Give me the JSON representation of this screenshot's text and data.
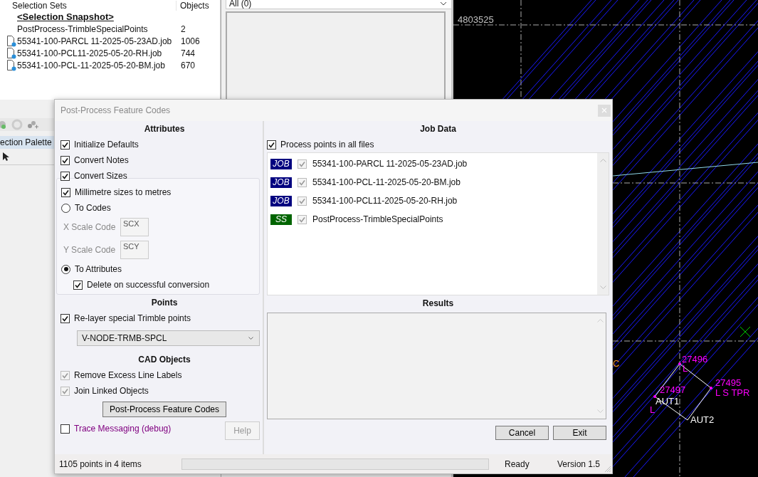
{
  "selection_sets": {
    "columns": [
      "Selection Sets",
      "Objects"
    ],
    "rows": [
      {
        "kind": "snapshot",
        "name": "<Selection Snapshot>"
      },
      {
        "kind": "set",
        "name": "PostProcess-TrimbleSpecialPoints",
        "objects": "2"
      },
      {
        "kind": "job",
        "name": "55341-100-PARCL 11-2025-05-23AD.job",
        "objects": "1006"
      },
      {
        "kind": "job",
        "name": "55341-100-PCL11-2025-05-20-RH.job",
        "objects": "744"
      },
      {
        "kind": "job",
        "name": "55341-100-PCL-11-2025-05-20-BM.job",
        "objects": "670"
      }
    ]
  },
  "filter": {
    "value": "All (0)"
  },
  "palette": {
    "tab": "ection Palette"
  },
  "cad": {
    "labels": [
      {
        "text": "4803525",
        "color": "#c0c0c0"
      },
      {
        "text": "C",
        "color": "#ff9933"
      },
      {
        "text": "27496",
        "color": "#ff00ff"
      },
      {
        "text": "L",
        "color": "#ff00ff"
      },
      {
        "text": "27495",
        "color": "#ff00ff"
      },
      {
        "text": "27497",
        "color": "#ff00ff"
      },
      {
        "text": "L S TPR",
        "color": "#ff00ff"
      },
      {
        "text": "AUT1",
        "color": "#ffffff"
      },
      {
        "text": "L",
        "color": "#ff00ff"
      },
      {
        "text": "AUT2",
        "color": "#ffffff"
      }
    ]
  },
  "dialog": {
    "title": "Post-Process Feature Codes",
    "attributes": {
      "heading": "Attributes",
      "options": [
        {
          "label": "Initialize Defaults",
          "checked": true
        },
        {
          "label": "Convert Notes",
          "checked": true
        }
      ],
      "convert_sizes": {
        "label": "Convert Sizes",
        "checked": true,
        "options": [
          {
            "kind": "checkbox",
            "label": "Millimetre sizes to metres",
            "checked": true
          },
          {
            "kind": "radio",
            "label": "To Codes",
            "selected": false
          },
          {
            "kind": "field",
            "label": "X Scale Code",
            "value": "SCX",
            "disabled": true
          },
          {
            "kind": "field",
            "label": "Y Scale Code",
            "value": "SCY",
            "disabled": true
          },
          {
            "kind": "radio",
            "label": "To Attributes",
            "selected": true,
            "children": [
              {
                "label": "Delete on successful conversion",
                "checked": true
              }
            ]
          }
        ]
      }
    },
    "points": {
      "heading": "Points",
      "relayer": {
        "label": "Re-layer special Trimble points",
        "checked": true
      },
      "layer": "V-NODE-TRMB-SPCL"
    },
    "cad_objects": {
      "heading": "CAD Objects",
      "options": [
        {
          "label": "Remove Excess Line Labels",
          "checked": true,
          "disabled": true
        },
        {
          "label": "Join Linked Objects",
          "checked": true,
          "disabled": true
        }
      ]
    },
    "action_button": "Post-Process Feature Codes",
    "trace": {
      "label": "Trace Messaging (debug)",
      "checked": false
    },
    "help": {
      "label": "Help",
      "disabled": true
    },
    "job_data": {
      "heading": "Job Data",
      "process_all": {
        "label": "Process points in all files",
        "checked": true
      },
      "files": [
        {
          "kind": "job",
          "badge": "JOB",
          "name": "55341-100-PARCL 11-2025-05-23AD.job",
          "checked": true,
          "disabled": true
        },
        {
          "kind": "job",
          "badge": "JOB",
          "name": "55341-100-PCL-11-2025-05-20-BM.job",
          "checked": true,
          "disabled": true
        },
        {
          "kind": "job",
          "badge": "JOB",
          "name": "55341-100-PCL11-2025-05-20-RH.job",
          "checked": true,
          "disabled": true
        },
        {
          "kind": "set",
          "badge": "SS",
          "name": "PostProcess-TrimbleSpecialPoints",
          "checked": true,
          "disabled": true
        }
      ]
    },
    "results": {
      "heading": "Results"
    },
    "buttons": [
      "Cancel",
      "Exit"
    ],
    "status_bar": {
      "summary": "1105 points in 4 items",
      "progress": {
        "level": 0
      },
      "state": "Ready",
      "version": "Version 1.5"
    }
  }
}
